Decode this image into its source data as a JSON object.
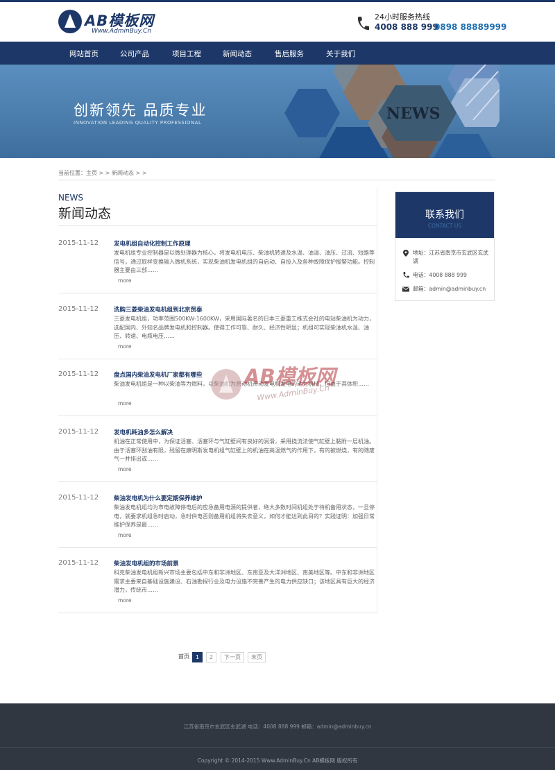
{
  "header": {
    "logo_text": "AB模板网",
    "logo_sub": "Www.AdminBuy.Cn",
    "hotline_label": "24小时服务热线",
    "hotline_1": "4008 888 999",
    "hotline_2": "0898 88889999"
  },
  "nav": {
    "items": [
      {
        "label": "网站首页"
      },
      {
        "label": "公司产品"
      },
      {
        "label": "项目工程"
      },
      {
        "label": "新闻动态"
      },
      {
        "label": "售后服务"
      },
      {
        "label": "关于我们"
      }
    ]
  },
  "banner": {
    "title": "创新领先  品质专业",
    "subtitle": "INNOVATION LEADING QUALITY PROFESSIONAL",
    "badge": "NEWS"
  },
  "breadcrumb": {
    "text": "当前位置：主页 >  > 新闻动态 >  >"
  },
  "main": {
    "heading_en": "NEWS",
    "heading_cn": "新闻动态",
    "more_label": "more",
    "news": [
      {
        "date": "2015-11-12",
        "title": "发电机组自动化控制工作原理",
        "desc": "发电机组专业控制器是以微处理器为核心，将发电机电压、柴油机转速及水温、油温、油压、过流、短路等信号，通过取样变换输入微机系统，实现柴油机发电机组的自启动、自投入及各种故障保护报警功能。控制器主要由三部……"
      },
      {
        "date": "2015-11-12",
        "title": "洗购三菱柴油发电机组到北京贸泰",
        "desc": "三菱发电机组，功率范围500KW-1600KW，采用国际著名的日本三菱重工株式会社的电站柴油机为动力，选配国内、外知名品牌发电机和控制器。使得工作可靠、耐久、经济性明显；机组可实现柴油机水温、油压、转速、电瓶电压……"
      },
      {
        "date": "2015-11-12",
        "title": "盘点国内柴油发电机厂家都有哪些",
        "desc": "柴油发电机组是一种以柴油等为燃料，以柴油机为原动机带动发电机发电的动力机械，但由于其体积……"
      },
      {
        "date": "2015-11-12",
        "title": "发电机耗油多怎么解决",
        "desc": "机油在正常使用中，为保证活塞、活塞环与气缸壁间有良好的润滑，采用挠流法使气缸壁上黏附一层机油。由于活塞环刮油有限，残留在康明斯发电机组气缸壁上的机油在高温燃气的作用下，有的被燃烧，有的随废气一并排出或……"
      },
      {
        "date": "2015-11-12",
        "title": "柴油发电机为什么要定期保养维护",
        "desc": "柴油发电机组均为市电故障停电后的应急备用电源的提供者，绝大多数时间机组处于待机备用状态，一旦停电，就要求机组急时启动，急时供电否则备用机组将失去意义，如何才能达到此目的？实践证明：加强日常维护保养是最……"
      },
      {
        "date": "2015-11-12",
        "title": "柴油发电机组的市场前景",
        "desc": "科克柴油发电机组新兴市场主要包括中东和非洲地区、东南亚及大洋洲地区、南美地区等。中东和非洲地区需求主要来自基础设施建设、石油勘探行业及电力设施不完善产生的电力供应缺口；该地区具有巨大的经济潜力，传统市……"
      }
    ]
  },
  "pager": {
    "first": "首页",
    "p1": "1",
    "p2": "2",
    "next": "下一页",
    "last": "末页"
  },
  "contact": {
    "title": "联系我们",
    "subtitle": "CONTACT US",
    "address": "地址：江苏省南京市玄武区玄武湖",
    "phone": "电话：4008 888 999",
    "email": "邮箱：admin@adminbuy.cn"
  },
  "watermark": {
    "text": "AB模板网",
    "sub": "Www.AdminBuy.Cn"
  },
  "footer": {
    "line1": "江苏省南京市玄武区玄武湖   电话：4008 888 999   邮箱：admin@adminbuy.cn",
    "line2": "Copyright © 2014-2015 Www.AdminBuy.Cn AB模板网 版权所有"
  },
  "colors": {
    "brand": "#1d3868",
    "banner": "#4f83b5",
    "footer": "#303741"
  }
}
